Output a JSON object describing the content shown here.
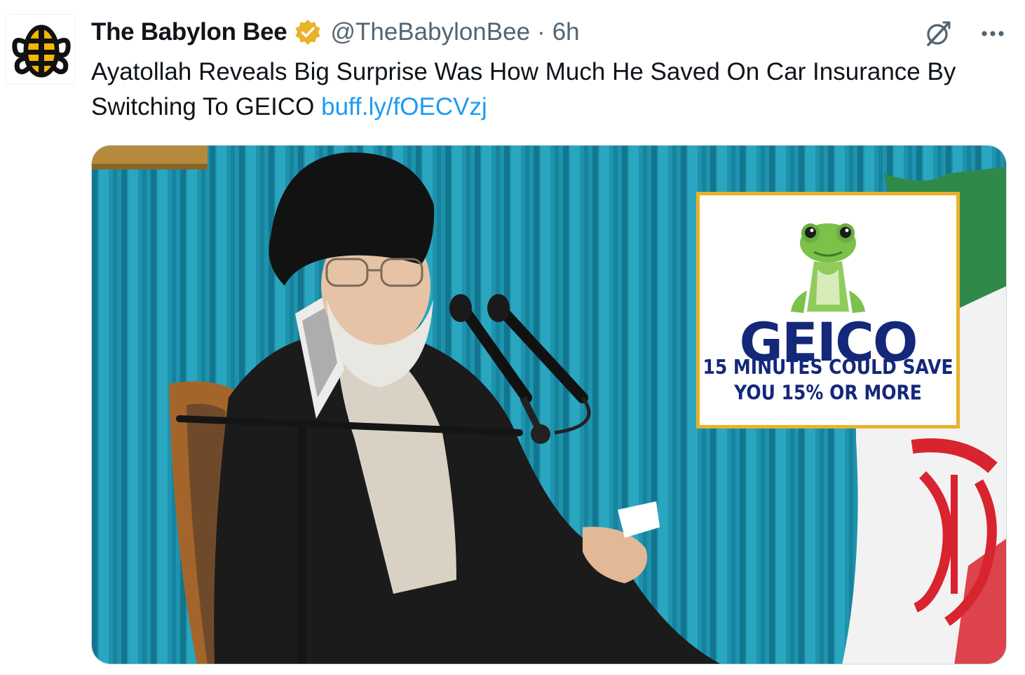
{
  "tweet": {
    "author": {
      "display_name": "The Babylon Bee",
      "handle": "@TheBabylonBee",
      "separator": "·",
      "timestamp": "6h",
      "verified_icon": "verified-badge-icon",
      "avatar_icon": "babylon-bee-logo"
    },
    "actions": {
      "grok_icon": "grok-icon",
      "more_icon": "more-options-icon"
    },
    "text": "Ayatollah Reveals Big Surprise Was How Much He Saved On Car Insurance By Switching To GEICO",
    "link": "buff.ly/fOECVzj",
    "media": {
      "geico_logo": "GEICO",
      "geico_tagline_line1": "15 MINUTES COULD SAVE",
      "geico_tagline_line2": "YOU 15% OR MORE"
    }
  },
  "colors": {
    "link": "#1d9bf0",
    "muted": "#536471",
    "text": "#0f1419",
    "verified_gold": "#e8b22a",
    "geico_blue": "#14287a"
  }
}
